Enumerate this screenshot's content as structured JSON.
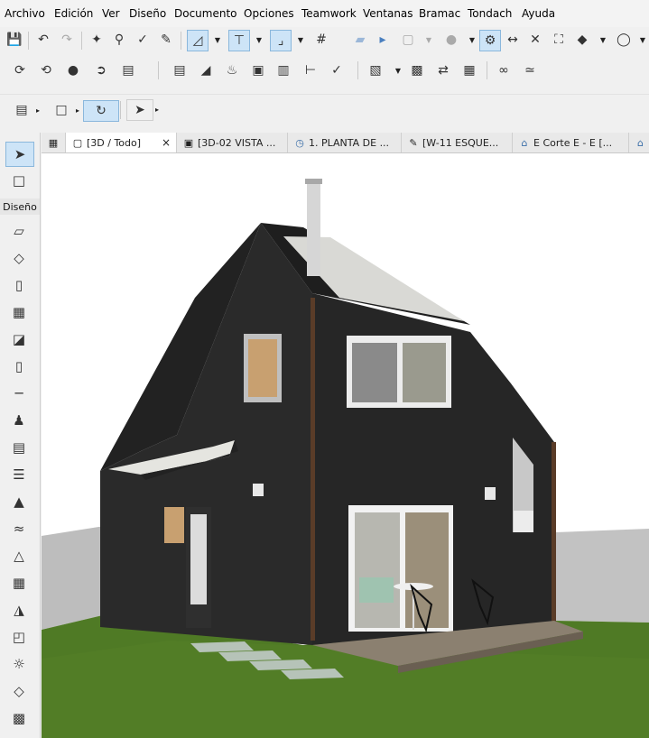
{
  "menu": [
    "Archivo",
    "Edición",
    "Ver",
    "Diseño",
    "Documento",
    "Opciones",
    "Teamwork",
    "Ventanas",
    "Bramac",
    "Tondach",
    "Ayuda"
  ],
  "tabs": [
    {
      "label": "[3D / Todo]",
      "icon": "cube-view-icon",
      "active": true,
      "close": "×"
    },
    {
      "label": "[3D-02 VISTA ...",
      "icon": "camera-view-icon"
    },
    {
      "label": "1. PLANTA DE ...",
      "icon": "floor-plan-icon"
    },
    {
      "label": "[W-11 ESQUE...",
      "icon": "detail-icon"
    },
    {
      "label": "E Corte E - E [...",
      "icon": "section-icon"
    }
  ],
  "toolbox": {
    "section_label": "Diseño"
  },
  "colors": {
    "accent": "#cde4f7",
    "house": "#262626",
    "grass": "#4f7a25",
    "wall": "#bcbcbc"
  }
}
